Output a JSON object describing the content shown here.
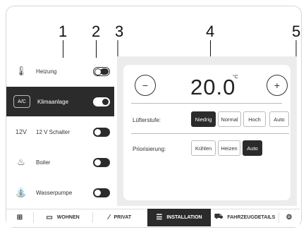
{
  "callouts": [
    "1",
    "2",
    "3",
    "4",
    "5"
  ],
  "sidebar": {
    "items": [
      {
        "label": "Heizung",
        "icon": "thermometer-icon",
        "glyph": "🌡",
        "toggle": "on"
      },
      {
        "label": "Klimaanlage",
        "icon": "ac-icon",
        "glyph": "A/C",
        "toggle": "on"
      },
      {
        "label": "12 V Schalter",
        "icon": "12v-icon",
        "glyph": "12V",
        "toggle": "off"
      },
      {
        "label": "Boiler",
        "icon": "flame-icon",
        "glyph": "♨",
        "toggle": "off"
      },
      {
        "label": "Wasserpumpe",
        "icon": "faucet-icon",
        "glyph": "⛲",
        "toggle": "off"
      }
    ]
  },
  "climate": {
    "minus": "−",
    "plus": "+",
    "temperature": "20.0",
    "unit": "°C",
    "fan_label": "Lüfterstufe:",
    "fan_options": [
      "Niedrig",
      "Normal",
      "Hoch",
      "Auto"
    ],
    "fan_selected": "Niedrig",
    "priority_label": "Priorisierung:",
    "priority_options": [
      "Kühlen",
      "Heizen",
      "Auto"
    ],
    "priority_selected": "Auto"
  },
  "nav": {
    "items": [
      {
        "label": "",
        "icon": "grid-icon",
        "glyph": "⊞"
      },
      {
        "label": "WOHNEN",
        "icon": "sofa-icon",
        "glyph": "▭"
      },
      {
        "label": "PRIVAT",
        "icon": "slash-icon",
        "glyph": "⁄"
      },
      {
        "label": "INSTALLATION",
        "icon": "installation-icon",
        "glyph": "☰"
      },
      {
        "label": "FAHRZEUGDETAILS",
        "icon": "van-icon",
        "glyph": "⛟"
      },
      {
        "label": "",
        "icon": "gear-icon",
        "glyph": "⚙"
      }
    ],
    "active": "INSTALLATION"
  }
}
